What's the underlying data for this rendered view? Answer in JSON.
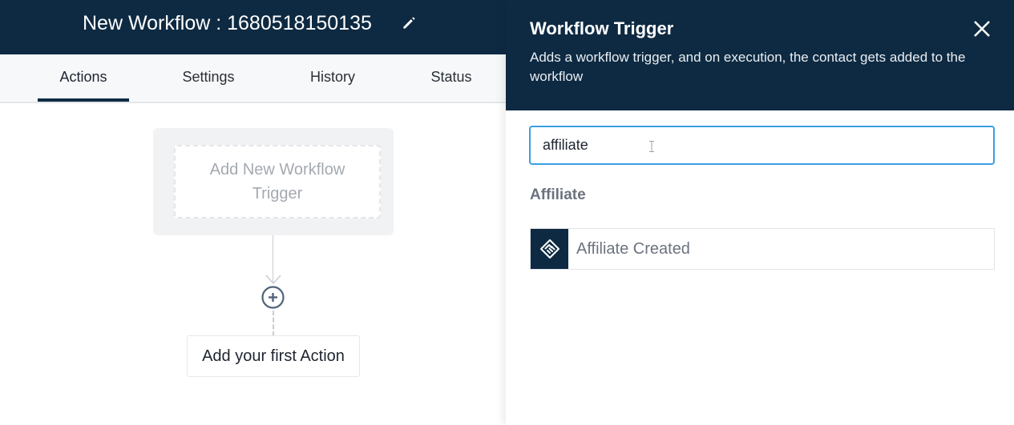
{
  "header": {
    "workflow_title": "New Workflow : 1680518150135"
  },
  "tabs": [
    {
      "label": "Actions",
      "active": true
    },
    {
      "label": "Settings",
      "active": false
    },
    {
      "label": "History",
      "active": false
    },
    {
      "label": "Status",
      "active": false
    }
  ],
  "canvas": {
    "trigger_placeholder": "Add New Workflow Trigger",
    "first_action_label": "Add your first Action"
  },
  "panel": {
    "title": "Workflow Trigger",
    "description": "Adds a workflow trigger, and on execution, the contact gets added to the workflow",
    "search": {
      "value": "affiliate"
    },
    "results": [
      {
        "group": "Affiliate",
        "items": [
          {
            "label": "Affiliate Created",
            "icon": "handshake-icon"
          }
        ]
      }
    ]
  },
  "colors": {
    "navy": "#0e2a42",
    "input_focus_border": "#3b9ee3",
    "muted_text": "#a4a9b0"
  }
}
